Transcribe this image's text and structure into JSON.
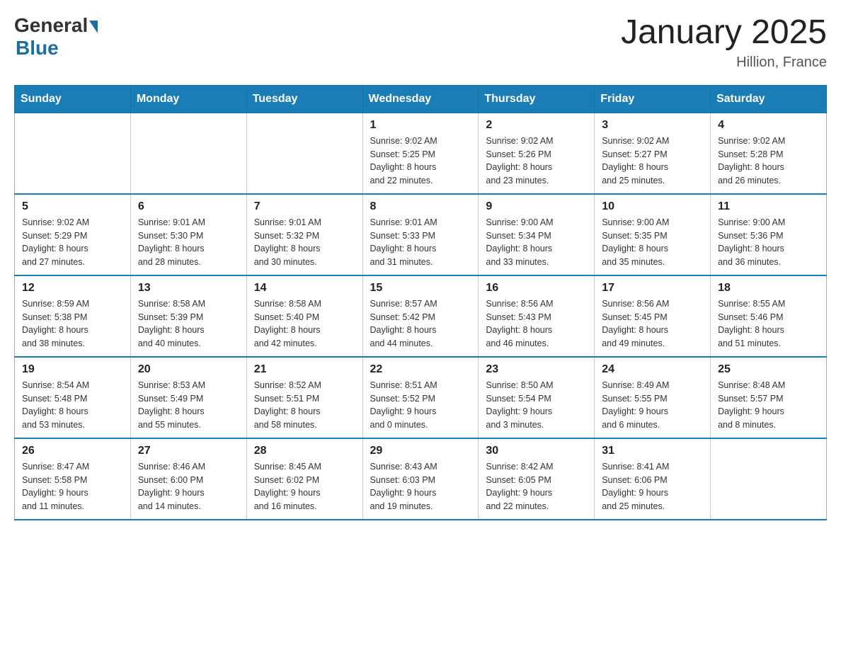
{
  "logo": {
    "general": "General",
    "blue": "Blue"
  },
  "title": "January 2025",
  "subtitle": "Hillion, France",
  "days_of_week": [
    "Sunday",
    "Monday",
    "Tuesday",
    "Wednesday",
    "Thursday",
    "Friday",
    "Saturday"
  ],
  "weeks": [
    [
      {
        "day": "",
        "info": ""
      },
      {
        "day": "",
        "info": ""
      },
      {
        "day": "",
        "info": ""
      },
      {
        "day": "1",
        "info": "Sunrise: 9:02 AM\nSunset: 5:25 PM\nDaylight: 8 hours\nand 22 minutes."
      },
      {
        "day": "2",
        "info": "Sunrise: 9:02 AM\nSunset: 5:26 PM\nDaylight: 8 hours\nand 23 minutes."
      },
      {
        "day": "3",
        "info": "Sunrise: 9:02 AM\nSunset: 5:27 PM\nDaylight: 8 hours\nand 25 minutes."
      },
      {
        "day": "4",
        "info": "Sunrise: 9:02 AM\nSunset: 5:28 PM\nDaylight: 8 hours\nand 26 minutes."
      }
    ],
    [
      {
        "day": "5",
        "info": "Sunrise: 9:02 AM\nSunset: 5:29 PM\nDaylight: 8 hours\nand 27 minutes."
      },
      {
        "day": "6",
        "info": "Sunrise: 9:01 AM\nSunset: 5:30 PM\nDaylight: 8 hours\nand 28 minutes."
      },
      {
        "day": "7",
        "info": "Sunrise: 9:01 AM\nSunset: 5:32 PM\nDaylight: 8 hours\nand 30 minutes."
      },
      {
        "day": "8",
        "info": "Sunrise: 9:01 AM\nSunset: 5:33 PM\nDaylight: 8 hours\nand 31 minutes."
      },
      {
        "day": "9",
        "info": "Sunrise: 9:00 AM\nSunset: 5:34 PM\nDaylight: 8 hours\nand 33 minutes."
      },
      {
        "day": "10",
        "info": "Sunrise: 9:00 AM\nSunset: 5:35 PM\nDaylight: 8 hours\nand 35 minutes."
      },
      {
        "day": "11",
        "info": "Sunrise: 9:00 AM\nSunset: 5:36 PM\nDaylight: 8 hours\nand 36 minutes."
      }
    ],
    [
      {
        "day": "12",
        "info": "Sunrise: 8:59 AM\nSunset: 5:38 PM\nDaylight: 8 hours\nand 38 minutes."
      },
      {
        "day": "13",
        "info": "Sunrise: 8:58 AM\nSunset: 5:39 PM\nDaylight: 8 hours\nand 40 minutes."
      },
      {
        "day": "14",
        "info": "Sunrise: 8:58 AM\nSunset: 5:40 PM\nDaylight: 8 hours\nand 42 minutes."
      },
      {
        "day": "15",
        "info": "Sunrise: 8:57 AM\nSunset: 5:42 PM\nDaylight: 8 hours\nand 44 minutes."
      },
      {
        "day": "16",
        "info": "Sunrise: 8:56 AM\nSunset: 5:43 PM\nDaylight: 8 hours\nand 46 minutes."
      },
      {
        "day": "17",
        "info": "Sunrise: 8:56 AM\nSunset: 5:45 PM\nDaylight: 8 hours\nand 49 minutes."
      },
      {
        "day": "18",
        "info": "Sunrise: 8:55 AM\nSunset: 5:46 PM\nDaylight: 8 hours\nand 51 minutes."
      }
    ],
    [
      {
        "day": "19",
        "info": "Sunrise: 8:54 AM\nSunset: 5:48 PM\nDaylight: 8 hours\nand 53 minutes."
      },
      {
        "day": "20",
        "info": "Sunrise: 8:53 AM\nSunset: 5:49 PM\nDaylight: 8 hours\nand 55 minutes."
      },
      {
        "day": "21",
        "info": "Sunrise: 8:52 AM\nSunset: 5:51 PM\nDaylight: 8 hours\nand 58 minutes."
      },
      {
        "day": "22",
        "info": "Sunrise: 8:51 AM\nSunset: 5:52 PM\nDaylight: 9 hours\nand 0 minutes."
      },
      {
        "day": "23",
        "info": "Sunrise: 8:50 AM\nSunset: 5:54 PM\nDaylight: 9 hours\nand 3 minutes."
      },
      {
        "day": "24",
        "info": "Sunrise: 8:49 AM\nSunset: 5:55 PM\nDaylight: 9 hours\nand 6 minutes."
      },
      {
        "day": "25",
        "info": "Sunrise: 8:48 AM\nSunset: 5:57 PM\nDaylight: 9 hours\nand 8 minutes."
      }
    ],
    [
      {
        "day": "26",
        "info": "Sunrise: 8:47 AM\nSunset: 5:58 PM\nDaylight: 9 hours\nand 11 minutes."
      },
      {
        "day": "27",
        "info": "Sunrise: 8:46 AM\nSunset: 6:00 PM\nDaylight: 9 hours\nand 14 minutes."
      },
      {
        "day": "28",
        "info": "Sunrise: 8:45 AM\nSunset: 6:02 PM\nDaylight: 9 hours\nand 16 minutes."
      },
      {
        "day": "29",
        "info": "Sunrise: 8:43 AM\nSunset: 6:03 PM\nDaylight: 9 hours\nand 19 minutes."
      },
      {
        "day": "30",
        "info": "Sunrise: 8:42 AM\nSunset: 6:05 PM\nDaylight: 9 hours\nand 22 minutes."
      },
      {
        "day": "31",
        "info": "Sunrise: 8:41 AM\nSunset: 6:06 PM\nDaylight: 9 hours\nand 25 minutes."
      },
      {
        "day": "",
        "info": ""
      }
    ]
  ]
}
